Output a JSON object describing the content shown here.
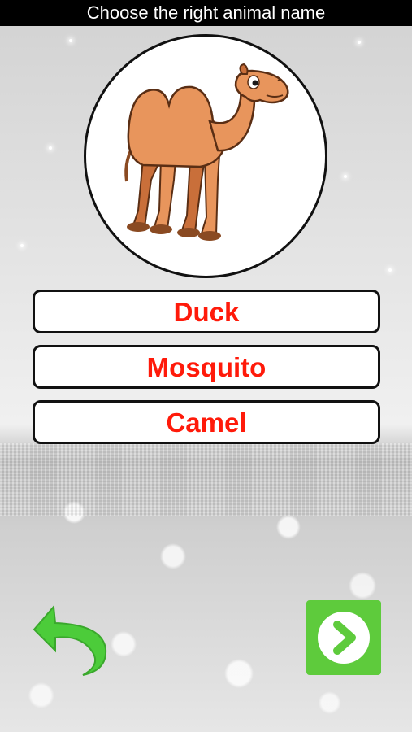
{
  "header": {
    "title": "Choose the right animal name"
  },
  "question": {
    "picture_icon": "camel-picture",
    "picture_colors": {
      "body": "#e8955c",
      "shade": "#c96f3a",
      "hooves": "#8a4a22",
      "outline": "#5a2e14"
    }
  },
  "answers": [
    {
      "label": "Duck"
    },
    {
      "label": "Mosquito"
    },
    {
      "label": "Camel"
    }
  ],
  "controls": {
    "back_icon": "undo-arrow-icon",
    "next_icon": "chevron-right-icon"
  },
  "colors": {
    "answer_text": "#ff1a0a",
    "accent_green": "#5ecb3c",
    "title_bar": "#000000"
  }
}
